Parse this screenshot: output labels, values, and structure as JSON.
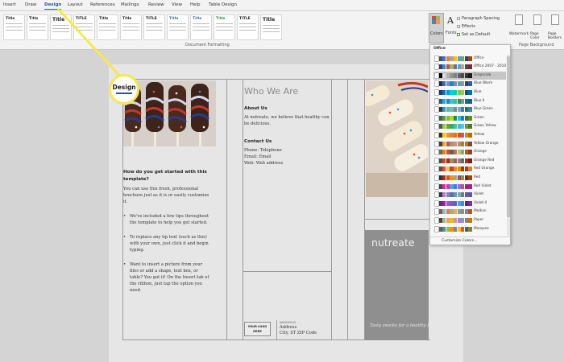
{
  "ribbon": {
    "tabs": [
      "Insert",
      "Draw",
      "Design",
      "Layout",
      "References",
      "Mailings",
      "Review",
      "View",
      "Help",
      "Table Design"
    ],
    "active_tab": "Design",
    "style_thumbs": [
      "Title",
      "Title",
      "Title",
      "TITLE",
      "Title",
      "Title",
      "TITLE",
      "Title",
      "Title",
      "Title",
      "TITLE",
      "Title"
    ],
    "colors_label": "Colors",
    "fonts_label": "Fonts",
    "paragraph_spacing_label": "Paragraph Spacing",
    "effects_label": "Effects",
    "set_default_label": "Set as Default",
    "watermark_label": "Watermark",
    "page_color_label": "Page Color",
    "page_borders_label": "Page Borders",
    "document_formatting_label": "Document Formatting",
    "page_background_label": "Page Background"
  },
  "callout": {
    "label": "Design"
  },
  "brochure": {
    "who_we_are": "Who We Are",
    "about_heading": "About Us",
    "about_text": [
      "At nutreate, we believe that healthy can",
      "be delicious."
    ],
    "contact_heading": "Contact Us",
    "contact_lines": [
      "Phone: Telephone",
      "Email: Email",
      "Web: Web address"
    ],
    "how_heading": [
      "How do you get started with this",
      "template?"
    ],
    "how_text": [
      "You can use this fresh, professional",
      "brochure just as it is or easily customize",
      "it."
    ],
    "bullets": [
      [
        "We've included a few tips throughout",
        "the template to help you get started."
      ],
      [
        "To replace any tip text (such as this)",
        "with your own, just click it and begin",
        "typing."
      ],
      [
        "Want to insert a picture from your",
        "files or add a shape, text box, or",
        "table? You got it! On the Insert tab of",
        "the ribbon, just tap the option you",
        "need."
      ]
    ],
    "logo_text": [
      "YOUR LOGO",
      "HERE"
    ],
    "address_small": "NAVIDEOUS",
    "address": "Address",
    "city": "City, ST ZIP Code",
    "brand": "nutreate",
    "tagline": "Tasty snacks for a healthy life"
  },
  "colors_menu": {
    "header": "Office",
    "customize_label": "Customize Colors...",
    "selected": "Grayscale",
    "themes": [
      {
        "name": "Office",
        "colors": [
          "#ffffff",
          "#44546a",
          "#4472c4",
          "#ed7d31",
          "#a5a5a5",
          "#ffc000",
          "#5b9bd5",
          "#70ad47",
          "#264478",
          "#9e480e"
        ]
      },
      {
        "name": "Office 2007 - 2010",
        "colors": [
          "#ffffff",
          "#1f497d",
          "#4f81bd",
          "#c0504d",
          "#9bbb59",
          "#8064a2",
          "#4bacc6",
          "#f79646",
          "#2c4d75",
          "#772c2a"
        ]
      },
      {
        "name": "Grayscale",
        "colors": [
          "#ffffff",
          "#000000",
          "#dddddd",
          "#b2b2b2",
          "#969696",
          "#808080",
          "#5f5f5f",
          "#4d4d4d",
          "#333333",
          "#1a1a1a"
        ]
      },
      {
        "name": "Blue Warm",
        "colors": [
          "#ffffff",
          "#242852",
          "#4a66ac",
          "#629dd1",
          "#297fd5",
          "#7f8fa9",
          "#5aa2ae",
          "#9d90a0",
          "#323d6b",
          "#2d5f99"
        ]
      },
      {
        "name": "Blue",
        "colors": [
          "#ffffff",
          "#17406d",
          "#0f6fc6",
          "#009dd9",
          "#0bd0d9",
          "#10cf9b",
          "#7cca62",
          "#a5c249",
          "#0b5294",
          "#007599"
        ]
      },
      {
        "name": "Blue II",
        "colors": [
          "#ffffff",
          "#335b74",
          "#1cade4",
          "#2683c6",
          "#27ced7",
          "#42ba97",
          "#3e8853",
          "#62a39f",
          "#146b8c",
          "#1c5c8a"
        ]
      },
      {
        "name": "Blue Green",
        "colors": [
          "#ffffff",
          "#373545",
          "#3494ba",
          "#58b6c0",
          "#75bda7",
          "#7a8c8e",
          "#84acb6",
          "#2683c6",
          "#246e8a",
          "#3b8a92"
        ]
      },
      {
        "name": "Green",
        "colors": [
          "#ffffff",
          "#455f51",
          "#549e39",
          "#8ab833",
          "#c0cf3a",
          "#029676",
          "#4ab5c4",
          "#0989b1",
          "#3e7529",
          "#65891f"
        ]
      },
      {
        "name": "Green Yellow",
        "colors": [
          "#ffffff",
          "#455f51",
          "#99cb38",
          "#63a537",
          "#37a76f",
          "#44c1a3",
          "#4eb3cf",
          "#51c3f9",
          "#729827",
          "#4a7b29"
        ]
      },
      {
        "name": "Yellow",
        "colors": [
          "#ffffff",
          "#39302a",
          "#ffca08",
          "#f8931d",
          "#ce8d3e",
          "#ec7016",
          "#e64823",
          "#9c6a6a",
          "#c29a00",
          "#b86c0d"
        ]
      },
      {
        "name": "Yellow Orange",
        "colors": [
          "#ffffff",
          "#4e3b30",
          "#f0a22e",
          "#a5644e",
          "#b58b80",
          "#c3986d",
          "#a19574",
          "#c17529",
          "#b7791e",
          "#7a4a3a"
        ]
      },
      {
        "name": "Orange",
        "colors": [
          "#ffffff",
          "#637052",
          "#e48312",
          "#bd582c",
          "#865640",
          "#9b8357",
          "#c2bc80",
          "#94a088",
          "#aa610d",
          "#8e4221"
        ]
      },
      {
        "name": "Orange Red",
        "colors": [
          "#ffffff",
          "#505046",
          "#d34817",
          "#9b2d1f",
          "#a28e6a",
          "#956251",
          "#918485",
          "#855d5d",
          "#9e3611",
          "#742217"
        ]
      },
      {
        "name": "Red Orange",
        "colors": [
          "#ffffff",
          "#505046",
          "#e84c22",
          "#ffbd47",
          "#b64926",
          "#ff8427",
          "#cc9900",
          "#b22600",
          "#b23919",
          "#bf8e35"
        ]
      },
      {
        "name": "Red",
        "colors": [
          "#ffffff",
          "#323232",
          "#a5300f",
          "#d55816",
          "#e19825",
          "#b19c7d",
          "#7f5f52",
          "#b27d49",
          "#7c240b",
          "#a04210"
        ]
      },
      {
        "name": "Red Violet",
        "colors": [
          "#ffffff",
          "#454551",
          "#e32d91",
          "#c830cc",
          "#4ea6dc",
          "#4775e7",
          "#8971e1",
          "#d54773",
          "#aa1f6c",
          "#962499"
        ]
      },
      {
        "name": "Violet",
        "colors": [
          "#ffffff",
          "#373545",
          "#ad84c6",
          "#8784c7",
          "#5d739a",
          "#6997af",
          "#84acb6",
          "#6f8183",
          "#7e4e9b",
          "#5d5aa5"
        ]
      },
      {
        "name": "Violet II",
        "colors": [
          "#ffffff",
          "#632e62",
          "#92278f",
          "#9b57d3",
          "#755dd9",
          "#665eb8",
          "#45a5ed",
          "#5982db",
          "#6d1d6b",
          "#7131a7"
        ]
      },
      {
        "name": "Median",
        "colors": [
          "#ffffff",
          "#775f55",
          "#94b6d2",
          "#dd8047",
          "#a5ab81",
          "#d8b25c",
          "#7ba79d",
          "#968c8c",
          "#5e8fb8",
          "#b35a24"
        ]
      },
      {
        "name": "Paper",
        "colors": [
          "#ffffff",
          "#444d26",
          "#a5b592",
          "#f3a447",
          "#e7bc29",
          "#d092a7",
          "#9c85c0",
          "#809ec2",
          "#7c8c66",
          "#c8730d"
        ]
      },
      {
        "name": "Marquee",
        "colors": [
          "#ffffff",
          "#5e5e5e",
          "#418ab3",
          "#a6b727",
          "#f69200",
          "#838383",
          "#fec306",
          "#df5327",
          "#316788",
          "#7c8a1d"
        ]
      }
    ]
  }
}
